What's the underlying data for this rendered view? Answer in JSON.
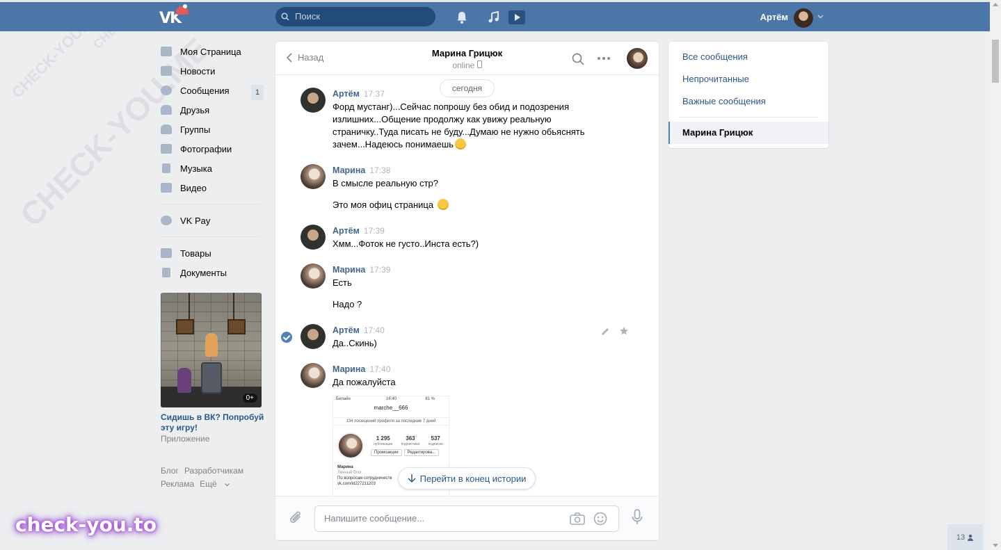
{
  "topbar": {
    "logo_text": "VK",
    "search_placeholder": "Поиск",
    "user_name": "Артём"
  },
  "nav": {
    "items": [
      {
        "label": "Моя Страница",
        "icon": "home-icon"
      },
      {
        "label": "Новости",
        "icon": "news-icon"
      },
      {
        "label": "Сообщения",
        "icon": "messages-icon",
        "badge": "1"
      },
      {
        "label": "Друзья",
        "icon": "friends-icon"
      },
      {
        "label": "Группы",
        "icon": "groups-icon"
      },
      {
        "label": "Фотографии",
        "icon": "photos-icon"
      },
      {
        "label": "Музыка",
        "icon": "music-icon"
      },
      {
        "label": "Видео",
        "icon": "video-icon"
      },
      {
        "label": "VK Pay",
        "icon": "vkpay-icon"
      },
      {
        "label": "Товары",
        "icon": "market-icon"
      },
      {
        "label": "Документы",
        "icon": "docs-icon"
      }
    ]
  },
  "ad": {
    "age": "0+",
    "title": "Сидишь в ВК? Попробуй эту игру!",
    "subtitle": "Приложение"
  },
  "footer": {
    "blog": "Блог",
    "developers": "Разработчикам",
    "ads": "Реклама",
    "more": "Ещё"
  },
  "chat": {
    "back_label": "Назад",
    "title": "Марина Грицюк",
    "status": "online",
    "day_label": "сегодня",
    "messages": [
      {
        "author": "Артём",
        "time": "17:37",
        "text": "Форд мустанг)...Сейчас попрошу без обид и подозрения излишних...Общение продолжу как увижу реальную страничку..Туда писать не буду...Думаю не нужно обьяснять зачем...Надеюсь понимаешь"
      },
      {
        "author": "Марина",
        "time": "17:38",
        "text": "В смысле реальную стр?",
        "text2": "Это моя офиц страница"
      },
      {
        "author": "Артём",
        "time": "17:39",
        "text": "Хмм...Фоток не густо..Инста есть?)"
      },
      {
        "author": "Марина",
        "time": "17:39",
        "text": "Есть",
        "text2": "Надо ?"
      },
      {
        "author": "Артём",
        "time": "17:40",
        "text": "Да..Скинь)"
      },
      {
        "author": "Марина",
        "time": "17:40",
        "text": "Да пожалуйста"
      }
    ],
    "attachment": {
      "carrier": "Билайн",
      "clock": "16:40",
      "battery": "81 %",
      "username": "marche__666",
      "visits": "134 посещений профиля за последние 7 дней",
      "posts_count": "1 295",
      "posts_label": "публикации",
      "followers_count": "363",
      "followers_label": "подписчики",
      "following_count": "537",
      "following_label": "подписки",
      "promo_btn": "Промоакции",
      "edit_btn": "Редактирова...",
      "bio_name": "Марина",
      "bio_line1": "Личный блог",
      "bio_line2": "По вопросам сотрудничеств",
      "bio_line3": "vk.com/id227211203"
    },
    "jump_label": "Перейти в конец истории",
    "composer_placeholder": "Напишите сообщение..."
  },
  "right_menu": {
    "all": "Все сообщения",
    "unread": "Непрочитанные",
    "important": "Важные сообщения",
    "active": "Марина Грицюк"
  },
  "watermark": {
    "brand": "check-you.to",
    "diag1": "CHECK-YOU.ME",
    "diag2": "CHECK-YOU.ME",
    "diag3": "CHECK-YOU.ME"
  },
  "online_count": "13",
  "colors": {
    "header": "#4a76a8",
    "link": "#2a5885",
    "name": "#42648b",
    "background": "#edeef0"
  }
}
